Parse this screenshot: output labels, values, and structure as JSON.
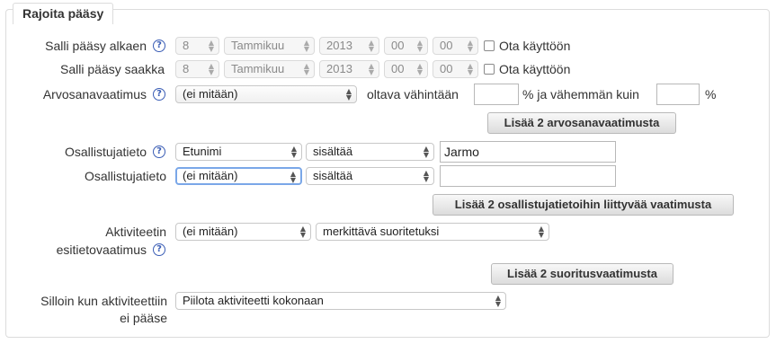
{
  "section": {
    "title": "Rajoita pääsy"
  },
  "from": {
    "label": "Salli pääsy alkaen",
    "day": "8",
    "month": "Tammikuu",
    "year": "2013",
    "hour": "00",
    "minute": "00",
    "enable_label": "Ota käyttöön"
  },
  "until": {
    "label": "Salli pääsy saakka",
    "day": "8",
    "month": "Tammikuu",
    "year": "2013",
    "hour": "00",
    "minute": "00",
    "enable_label": "Ota käyttöön"
  },
  "grade": {
    "label": "Arvosanavaatimus",
    "select_value": "(ei mitään)",
    "min_label": "oltava vähintään",
    "percent_and_less_label": "% ja vähemmän kuin",
    "percent_label": "%",
    "min_value": "",
    "max_value": "",
    "add_button": "Lisää 2 arvosanavaatimusta"
  },
  "user_fields": [
    {
      "label": "Osallistujatieto",
      "field": "Etunimi",
      "operator": "sisältää",
      "value": "Jarmo"
    },
    {
      "label": "Osallistujatieto",
      "field": "(ei mitään)",
      "operator": "sisältää",
      "value": ""
    }
  ],
  "user_fields_add_button": "Lisää 2 osallistujatietoihin liittyvää vaatimusta",
  "completion": {
    "label_line1": "Aktiviteetin",
    "label_line2": "esitietovaatimus",
    "activity": "(ei mitään)",
    "condition": "merkittävä suoritetuksi",
    "add_button": "Lisää 2 suoritusvaatimusta"
  },
  "show_availability": {
    "label_line1": "Silloin kun aktiviteettiin",
    "label_line2": "ei pääse",
    "value": "Piilota aktiviteetti kokonaan"
  },
  "icons": {
    "help": "help-icon",
    "select_arrows": "updown-arrows-icon"
  },
  "colors": {
    "help_icon": "#3a5db5",
    "focus_ring": "#7aa7e8"
  }
}
